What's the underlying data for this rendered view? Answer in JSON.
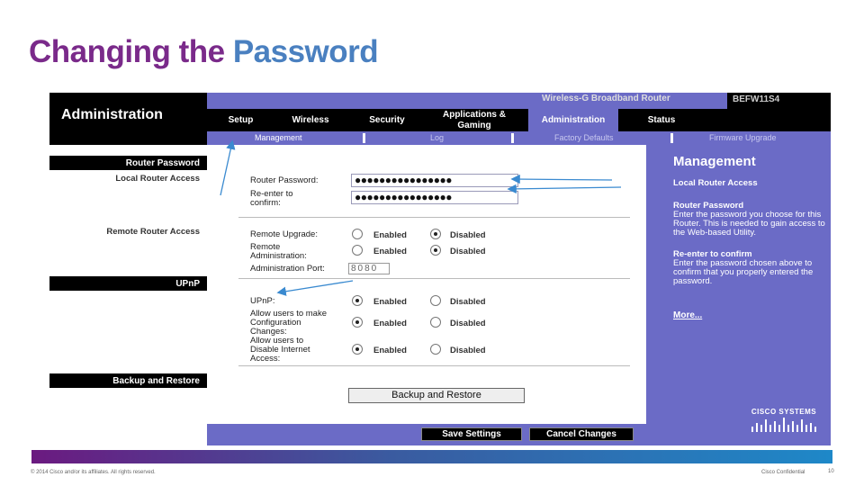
{
  "slide": {
    "title_part1": "Changing the ",
    "title_part2": "Password",
    "footer_left": "© 2014 Cisco and/or its affiliates. All rights reserved.",
    "footer_right": "Cisco Confidential",
    "page_number": "10"
  },
  "router": {
    "product": "Wireless-G Broadband Router",
    "model": "BEFW11S4",
    "section_title": "Administration",
    "tabs": [
      {
        "label": "Setup"
      },
      {
        "label": "Wireless"
      },
      {
        "label": "Security"
      },
      {
        "label": "Applications & Gaming"
      },
      {
        "label": "Administration"
      },
      {
        "label": "Status"
      }
    ],
    "subtabs": [
      {
        "label": "Management"
      },
      {
        "label": "Log"
      },
      {
        "label": "Factory Defaults"
      },
      {
        "label": "Firmware Upgrade"
      }
    ],
    "left": {
      "router_password": "Router Password",
      "local_access": "Local Router Access",
      "remote_access": "Remote Router Access",
      "upnp": "UPnP",
      "backup": "Backup and Restore"
    },
    "form": {
      "router_password_label": "Router Password:",
      "router_password_value": "●●●●●●●●●●●●●●●●",
      "reenter_label_1": "Re-enter to",
      "reenter_label_2": "confirm:",
      "reenter_value": "●●●●●●●●●●●●●●●●",
      "remote_upgrade": "Remote Upgrade:",
      "remote_admin_1": "Remote",
      "remote_admin_2": "Administration:",
      "admin_port_label": "Administration Port:",
      "admin_port_value": "8080",
      "upnp_label": "UPnP:",
      "allow_config_1": "Allow users to make",
      "allow_config_2": "Configuration",
      "allow_config_3": "Changes:",
      "allow_disable_1": "Allow users to",
      "allow_disable_2": "Disable Internet",
      "allow_disable_3": "Access:",
      "enabled": "Enabled",
      "disabled": "Disabled",
      "backup_button": "Backup and Restore",
      "save_button": "Save Settings",
      "cancel_button": "Cancel Changes"
    },
    "help": {
      "title": "Management",
      "local_access": "Local Router Access",
      "router_password_head": "Router Password",
      "router_password_text": "Enter the password you choose for this Router. This is needed to gain access to the Web-based Utility.",
      "reenter_head": "Re-enter to confirm",
      "reenter_text": "Enter the password chosen above to confirm that you properly entered the password.",
      "more": "More...",
      "cisco": "CISCO SYSTEMS"
    }
  }
}
